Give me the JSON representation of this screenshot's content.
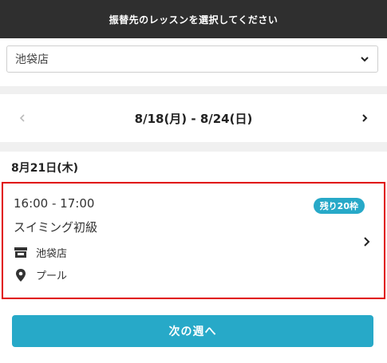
{
  "header": {
    "title": "振替先のレッスンを選択してください"
  },
  "store_select": {
    "value": "池袋店",
    "icon": "chevron-down-icon"
  },
  "week_nav": {
    "range": "8/18(月) - 8/24(日)",
    "prev_icon": "chevron-left-icon",
    "next_icon": "chevron-right-icon"
  },
  "day": {
    "title": "8月21日(木)",
    "lessons": [
      {
        "time": "16:00 - 17:00",
        "name": "スイミング初級",
        "badge": "残り20枠",
        "store": "池袋店",
        "place": "プール",
        "store_icon": "store-icon",
        "place_icon": "location-pin-icon"
      }
    ]
  },
  "footer": {
    "next_week_label": "次の週へ"
  },
  "colors": {
    "accent": "#27a9c8",
    "header_bg": "#2f2f2f",
    "highlight_border": "#e00000"
  }
}
